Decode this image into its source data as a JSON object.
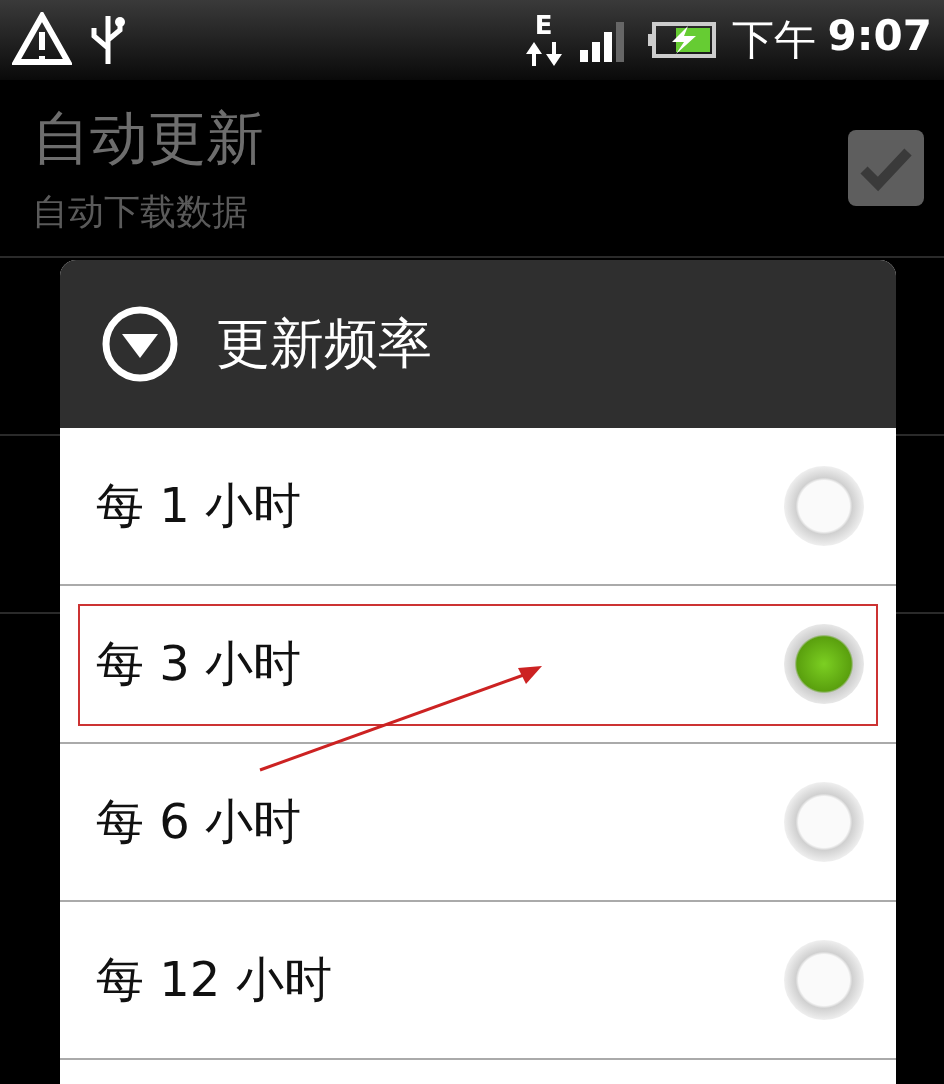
{
  "status_bar": {
    "time_period": "下午",
    "time": "9:07",
    "network_type": "E"
  },
  "settings": [
    {
      "title": "自动更新",
      "subtitle": "自动下载数据",
      "kind": "checkbox",
      "checked": true
    }
  ],
  "dialog": {
    "title": "更新频率",
    "options": [
      {
        "label": "每 1 小时",
        "selected": false,
        "highlighted": false
      },
      {
        "label": "每 3 小时",
        "selected": true,
        "highlighted": true
      },
      {
        "label": "每 6 小时",
        "selected": false,
        "highlighted": false
      },
      {
        "label": "每 12 小时",
        "selected": false,
        "highlighted": false
      }
    ]
  }
}
